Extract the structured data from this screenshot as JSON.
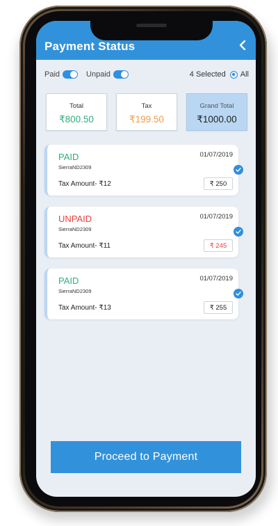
{
  "header": {
    "title": "Payment Status"
  },
  "filters": {
    "paid_label": "Paid",
    "unpaid_label": "Unpaid",
    "selected_count": "4 Selected",
    "all_label": "All"
  },
  "summary": {
    "total": {
      "label": "Total",
      "value": "₹800.50"
    },
    "tax": {
      "label": "Tax",
      "value": "₹199.50"
    },
    "grand_total": {
      "label": "Grand Total",
      "value": "₹1000.00"
    }
  },
  "payments": [
    {
      "status": "PAID",
      "code": "SierraND2309",
      "date": "01/07/2019",
      "tax_label": "Tax Amount- ₹12",
      "amount": "₹ 250"
    },
    {
      "status": "UNPAID",
      "code": "SierraND2309",
      "date": "01/07/2019",
      "tax_label": "Tax Amount- ₹11",
      "amount": "₹ 245"
    },
    {
      "status": "PAID",
      "code": "SierraND2309",
      "date": "01/07/2019",
      "tax_label": "Tax Amount- ₹13",
      "amount": "₹ 255"
    }
  ],
  "cta": {
    "label": "Proceed to Payment"
  },
  "colors": {
    "primary": "#3192db",
    "paid": "#2fae7c",
    "unpaid": "#e8403a",
    "tax": "#f59a45",
    "grand_bg": "#b9d7f3"
  },
  "icons": {
    "back": "chevron-left-icon",
    "check": "check-circle-icon"
  }
}
